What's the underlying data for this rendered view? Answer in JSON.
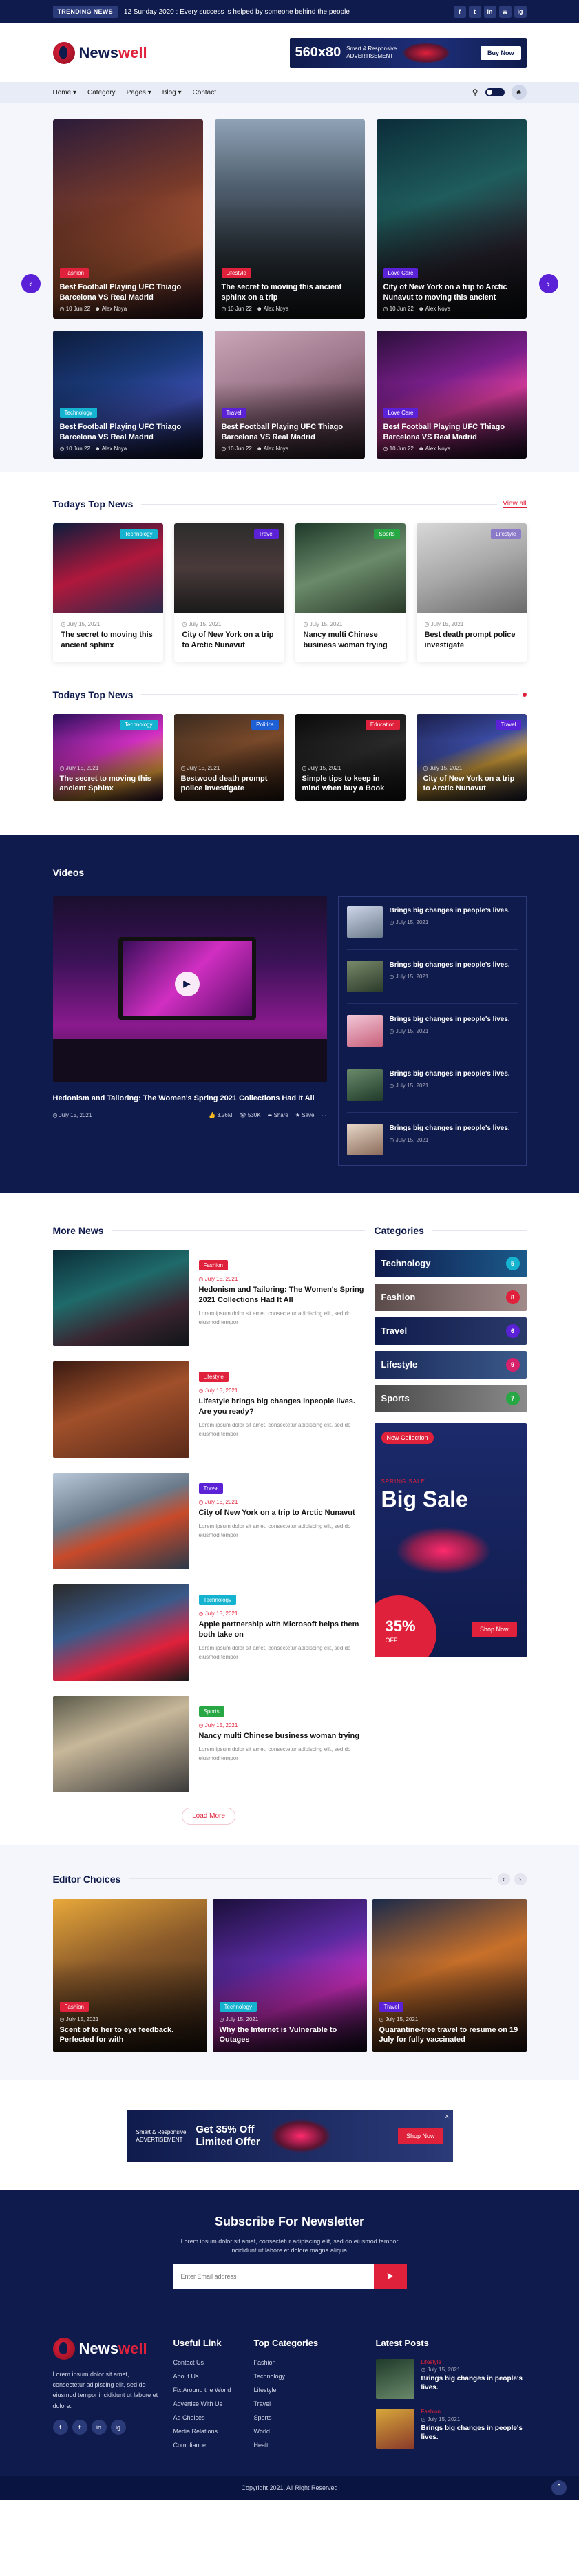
{
  "topbar": {
    "trending_label": "TRENDING NEWS",
    "trending_text": "12 Sunday 2020 : Every success is helped by someone behind the people",
    "socials": [
      "f",
      "t",
      "in",
      "w",
      "ig"
    ]
  },
  "header": {
    "logo_main": "News",
    "logo_accent": "well",
    "ad_size": "560x80",
    "ad_label_1": "Smart & Responsive",
    "ad_label_2": "ADVERTISEMENT",
    "ad_button": "Buy Now"
  },
  "nav": {
    "items": [
      "Home ▾",
      "Category",
      "Pages ▾",
      "Blog ▾",
      "Contact"
    ]
  },
  "hero": {
    "cards": [
      {
        "tag": "Fashion",
        "tag_color": "#e0213b",
        "title": "Best Football Playing UFC Thiago Barcelona VS Real Madrid",
        "date": "10 Jun 22",
        "author": "Alex Noya",
        "bg": "linear-gradient(160deg,#2b1b3a 0%,#7a3b2a 45%,#c3633b 70%,#3a1a2b 100%)"
      },
      {
        "tag": "Lifestyle",
        "tag_color": "#e0213b",
        "title": "The secret to moving this ancient sphinx on a trip",
        "date": "10 Jun 22",
        "author": "Alex Noya",
        "bg": "linear-gradient(180deg,#8fa3b7 0%,#4d5c6b 35%,#2c353d 70%,#1c2125 100%)"
      },
      {
        "tag": "Love Care",
        "tag_color": "#5b21d6",
        "title": "City of New York on a trip to Arctic Nunavut to moving this ancient",
        "date": "10 Jun 22",
        "author": "Alex Noya",
        "bg": "linear-gradient(160deg,#0b2d3a 0%,#1f5c5c 40%,#2a2430 70%,#0f1418 100%)"
      },
      {
        "tag": "Technology",
        "tag_color": "#15b3cf",
        "title": "Best Football Playing UFC Thiago Barcelona VS Real Madrid",
        "date": "10 Jun 22",
        "author": "Alex Noya",
        "bg": "linear-gradient(160deg,#0c1c3c 0%,#1b3a7a 40%,#3d4fb3 65%,#11173a 100%)"
      },
      {
        "tag": "Travel",
        "tag_color": "#5b21d6",
        "title": "Best Football Playing UFC Thiago Barcelona VS Real Madrid",
        "date": "10 Jun 22",
        "author": "Alex Noya",
        "bg": "linear-gradient(160deg,#c9a6b8 0%,#a07a8e 40%,#6a4a5a 70%,#3a2a33 100%)"
      },
      {
        "tag": "Love Care",
        "tag_color": "#5b21d6",
        "title": "Best Football Playing UFC Thiago Barcelona VS Real Madrid",
        "date": "10 Jun 22",
        "author": "Alex Noya",
        "bg": "linear-gradient(160deg,#2a0f3a 0%,#7a1f8a 40%,#d33a9a 60%,#241034 100%)"
      }
    ]
  },
  "top_news": {
    "title": "Todays Top News",
    "view_all": "View all",
    "cards": [
      {
        "tag": "Technology",
        "tag_color": "#15b3cf",
        "date": "July 15, 2021",
        "title": "The secret to moving this ancient sphinx",
        "bg": "linear-gradient(160deg,#0c1c3c 0%,#b0183c 50%,#2a2a4a 100%)"
      },
      {
        "tag": "Travel",
        "tag_color": "#5b21d6",
        "date": "July 15, 2021",
        "title": "City of New York on a trip to Arctic Nunavut",
        "bg": "linear-gradient(180deg,#2c2c2c 0%,#4a3a3a 50%,#1a1a1a 100%)"
      },
      {
        "tag": "Sports",
        "tag_color": "#28a745",
        "date": "July 15, 2021",
        "title": "Nancy multi Chinese business woman trying",
        "bg": "linear-gradient(160deg,#1f3a2a 0%,#6a8a6a 50%,#2a3a2a 100%)"
      },
      {
        "tag": "Lifestyle",
        "tag_color": "#8a7ac8",
        "date": "July 15, 2021",
        "title": "Best death prompt police investigate",
        "bg": "linear-gradient(160deg,#d8d8d8 0%,#a8a8a8 50%,#6a6a6a 100%)"
      }
    ]
  },
  "top_news_2": {
    "title": "Todays Top News",
    "cards": [
      {
        "tag": "Technology",
        "tag_color": "#15b3cf",
        "date": "July 15, 2021",
        "title": "The secret to moving this ancient Sphinx",
        "bg": "linear-gradient(160deg,#2a0f5a 0%,#d12fc2 45%,#e8a23a 75%,#2a0f3a 100%)"
      },
      {
        "tag": "Politics",
        "tag_color": "#1e5fd6",
        "date": "July 15, 2021",
        "title": "Bestwood death prompt police investigate",
        "bg": "linear-gradient(160deg,#3a2a1f 0%,#7a4a2a 45%,#2a1a12 100%)"
      },
      {
        "tag": "Education",
        "tag_color": "#e0213b",
        "date": "July 15, 2021",
        "title": "Simple tips to keep in mind when buy a Book",
        "bg": "linear-gradient(160deg,#0a0a0a 0%,#2a2a2a 50%,#141414 100%)"
      },
      {
        "tag": "Travel",
        "tag_color": "#5b21d6",
        "date": "July 15, 2021",
        "title": "City of New York on a trip to Arctic Nunavut",
        "bg": "linear-gradient(160deg,#1a1f4a 0%,#3a4aa0 40%,#d3a03a 60%,#1a1f3a 100%)"
      }
    ]
  },
  "videos": {
    "title": "Videos",
    "main_title": "Hedonism and Tailoring: The Women's Spring 2021 Collections Had It All",
    "main_date": "July 15, 2021",
    "likes": "3.26M",
    "views": "530K",
    "share": "Share",
    "save": "Save",
    "side": [
      {
        "title": "Brings big changes in people's lives.",
        "date": "July 15, 2021",
        "bg": "linear-gradient(160deg,#cfd6ea,#6a7a8a)"
      },
      {
        "title": "Brings big changes in people's lives.",
        "date": "July 15, 2021",
        "bg": "linear-gradient(160deg,#7a8a6a,#2a3a2a)"
      },
      {
        "title": "Brings big changes in people's lives.",
        "date": "July 15, 2021",
        "bg": "linear-gradient(160deg,#f2c7d8,#c8607a)"
      },
      {
        "title": "Brings big changes in people's lives.",
        "date": "July 15, 2021",
        "bg": "linear-gradient(160deg,#6a8a6a,#1f3a2a)"
      },
      {
        "title": "Brings big changes in people's lives.",
        "date": "July 15, 2021",
        "bg": "linear-gradient(160deg,#e8d8c8,#8a6a5a)"
      }
    ]
  },
  "more_news": {
    "title": "More News",
    "load_more": "Load More",
    "items": [
      {
        "tag": "Fashion",
        "tag_color": "#e0213b",
        "date": "July 15, 2021",
        "title": "Hedonism and Tailoring: The Women's Spring 2021 Collections Had It All",
        "excerpt": "Lorem ipsum dolor sit amet, consectetur adipiscing elit, sed do eiusmod tempor",
        "bg": "linear-gradient(160deg,#0b2d3a 0%,#1f6a6a 40%,#3a2430 70%,#0f1418 100%)"
      },
      {
        "tag": "Lifestyle",
        "tag_color": "#e0213b",
        "date": "July 15, 2021",
        "title": "Lifestyle brings big changes inpeople lives. Are you ready?",
        "excerpt": "Lorem ipsum dolor sit amet, consectetur adipiscing elit, sed do eiusmod tempor",
        "bg": "linear-gradient(160deg,#3a1a12 0%,#a0502a 45%,#5a2a1a 100%)"
      },
      {
        "tag": "Travel",
        "tag_color": "#5b21d6",
        "date": "July 15, 2021",
        "title": "City of New York on a trip to Arctic Nunavut",
        "excerpt": "Lorem ipsum dolor sit amet, consectetur adipiscing elit, sed do eiusmod tempor",
        "bg": "linear-gradient(160deg,#b8c8d8 0%,#6a7a8a 40%,#c84a2a 60%,#2a3a4a 100%)"
      },
      {
        "tag": "Technology",
        "tag_color": "#15b3cf",
        "date": "July 15, 2021",
        "title": "Apple partnership with Microsoft helps them both take on",
        "excerpt": "Lorem ipsum dolor sit amet, consectetur adipiscing elit, sed do eiusmod tempor",
        "bg": "linear-gradient(160deg,#2a2a2a 0%,#3a5a8a 40%,#e0213b 70%,#1a1a1a 100%)"
      },
      {
        "tag": "Sports",
        "tag_color": "#28a745",
        "date": "July 15, 2021",
        "title": "Nancy multi Chinese business woman trying",
        "excerpt": "Lorem ipsum dolor sit amet, consectetur adipiscing elit, sed do eiusmod tempor",
        "bg": "linear-gradient(160deg,#5a5a4a 0%,#c8b89a 40%,#3a3a3a 100%)"
      }
    ]
  },
  "categories": {
    "title": "Categories",
    "items": [
      {
        "name": "Technology",
        "count": "5",
        "bg": "linear-gradient(90deg,#0f1b4c,#1b5a8a)",
        "cnt_color": "#15b3cf"
      },
      {
        "name": "Fashion",
        "count": "8",
        "bg": "linear-gradient(90deg,#5a4a4a,#a08a8a)",
        "cnt_color": "#e0213b"
      },
      {
        "name": "Travel",
        "count": "6",
        "bg": "linear-gradient(90deg,#0f1b4c,#2a3a6a)",
        "cnt_color": "#5b21d6"
      },
      {
        "name": "Lifestyle",
        "count": "9",
        "bg": "linear-gradient(90deg,#1b2a5a,#3a5a8a)",
        "cnt_color": "#d6216b"
      },
      {
        "name": "Sports",
        "count": "7",
        "bg": "linear-gradient(90deg,#4a4a4a,#8a8a8a)",
        "cnt_color": "#28a745"
      }
    ]
  },
  "sale_ad": {
    "badge": "New Collection",
    "sub": "SPRING SALE",
    "big": "Big Sale",
    "percent": "35%",
    "off": "OFF",
    "button": "Shop Now"
  },
  "editor": {
    "title": "Editor Choices",
    "cards": [
      {
        "tag": "Fashion",
        "tag_color": "#e0213b",
        "date": "July 15, 2021",
        "title": "Scent of to her to eye feedback. Perfected for with",
        "bg": "linear-gradient(160deg,#e8a83a 0%,#8a5a2a 40%,#2a1a12 100%)"
      },
      {
        "tag": "Technology",
        "tag_color": "#15b3cf",
        "date": "July 15, 2021",
        "title": "Why the Internet is Vulnerable to Outages",
        "bg": "linear-gradient(160deg,#1a0f3a 0%,#5a2aa0 40%,#d12fc2 65%,#1a1030 100%)"
      },
      {
        "tag": "Travel",
        "tag_color": "#5b21d6",
        "date": "July 15, 2021",
        "title": "Quarantine-free travel to resume on 19 July for fully vaccinated",
        "bg": "linear-gradient(160deg,#1a2a4a 0%,#c8702a 45%,#2a1a1a 100%)"
      }
    ]
  },
  "promo": {
    "label_1": "Smart & Responsive",
    "label_2": "ADVERTISEMENT",
    "offer_1": "Get 35% Off",
    "offer_2": "Limited Offer",
    "button": "Shop Now",
    "close": "x"
  },
  "newsletter": {
    "title": "Subscribe For Newsletter",
    "text": "Lorem ipsum dolor sit amet, consectetur adipiscing elit, sed do eiusmod tempor incididunt ut labore et dolore magna aliqua.",
    "placeholder": "Enter Email address"
  },
  "footer": {
    "about": "Lorem ipsum dolor sit amet, consectetur adipiscing elit, sed do eiusmod tempor incididunt ut labore et dolore.",
    "socials": [
      "f",
      "t",
      "in",
      "ig"
    ],
    "useful_title": "Useful Link",
    "useful": [
      "Contact Us",
      "About Us",
      "Fix Around the World",
      "Advertise With Us",
      "Ad Choices",
      "Media Relations",
      "Compliance"
    ],
    "cat_title": "Top Categories",
    "cats": [
      "Fashion",
      "Technology",
      "Lifestyle",
      "Travel",
      "Sports",
      "World",
      "Health"
    ],
    "latest_title": "Latest Posts",
    "latest": [
      {
        "tag": "Lifestyle",
        "date": "July 15, 2021",
        "title": "Brings big changes in people's lives.",
        "bg": "linear-gradient(160deg,#1f3a2a,#6a8a6a)"
      },
      {
        "tag": "Fashion",
        "date": "July 15, 2021",
        "title": "Brings big changes in people's lives.",
        "bg": "linear-gradient(160deg,#d8a83a,#8a3a2a)"
      }
    ],
    "copyright": "Copyright 2021. All Right Reserved"
  }
}
